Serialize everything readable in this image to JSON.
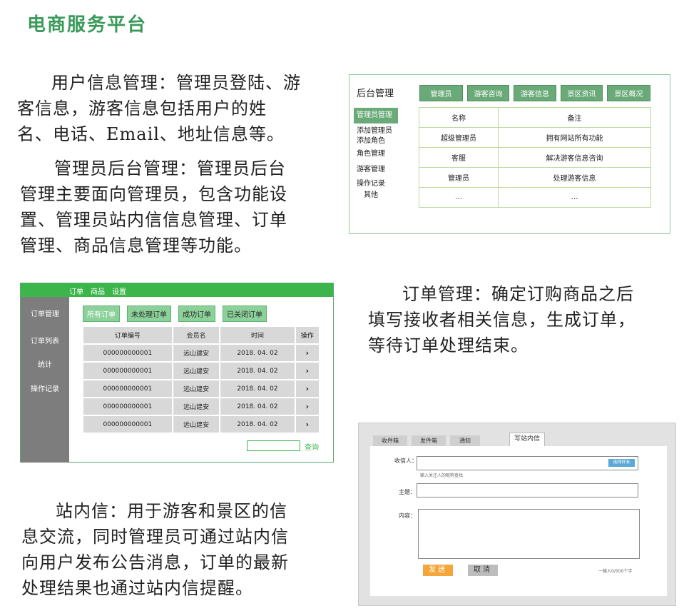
{
  "title": "电商服务平台",
  "paragraphs": {
    "user_info_lines": [
      "用户信息管理：管理员登陆、游",
      "客信息，游客信息包括用户的姓",
      "名、电话、Email、地址信息等。"
    ],
    "admin_lines": [
      "管理员后台管理：管理员后台",
      "管理主要面向管理员，包含功能设",
      "置、管理员站内信信息管理、订单",
      "管理、商品信息管理等功能。"
    ],
    "order_lines": [
      "订单管理：确定订购商品之后",
      "填写接收者相关信息，生成订单，",
      "等待订单处理结束。"
    ],
    "message_lines": [
      "站内信：用于游客和景区的信",
      "息交流，同时管理员可通过站内信",
      "向用户发布公告消息，订单的最新",
      "处理结果也通过站内信提醒。"
    ]
  },
  "admin_panel": {
    "title": "后台管理",
    "tabs": [
      "管理员",
      "游客咨询",
      "游客信息",
      "景区资讯",
      "景区概况"
    ],
    "sidebar": [
      "管理员管理",
      "添加管理员",
      "添加角色",
      "角色管理",
      "游客管理",
      "操作记录",
      "其他"
    ],
    "table": {
      "headers": [
        "名称",
        "备注"
      ],
      "rows": [
        [
          "超级管理员",
          "拥有网站所有功能"
        ],
        [
          "客服",
          "解决游客信息咨询"
        ],
        [
          "管理员",
          "处理游客信息"
        ],
        [
          "…",
          "…"
        ]
      ]
    }
  },
  "order_panel": {
    "top_nav": [
      "订单",
      "商品",
      "设置"
    ],
    "sidebar": [
      "订单管理",
      "订单列表",
      "统计",
      "操作记录"
    ],
    "filters": [
      "所有订单",
      "未处理订单",
      "成功订单",
      "已关闭订单"
    ],
    "table": {
      "headers": [
        "订单编号",
        "会员名",
        "时间",
        "操作"
      ],
      "rows": [
        [
          "000000000001",
          "远山建安",
          "2018. 04. 02",
          "›"
        ],
        [
          "000000000001",
          "远山建安",
          "2018. 04. 02",
          "›"
        ],
        [
          "000000000001",
          "远山建安",
          "2018. 04. 02",
          "›"
        ],
        [
          "000000000001",
          "远山建安",
          "2018. 04. 02",
          "›"
        ],
        [
          "000000000001",
          "远山建安",
          "2018. 04. 02",
          "›"
        ]
      ]
    },
    "search_value": "",
    "search_label": "查询"
  },
  "message_panel": {
    "tabs": [
      "收件箱",
      "发件箱",
      "通知",
      "写站内信"
    ],
    "recipient_label": "收信人：",
    "recipient_value": "",
    "select_friend": "选择好友",
    "recipient_hint": "输入关注人的昵称查找",
    "subject_label": "主题：",
    "subject_value": "",
    "content_label": "内容：",
    "content_value": "",
    "send": "发送",
    "cancel": "取消",
    "char_count": "一输入0/500个字"
  }
}
